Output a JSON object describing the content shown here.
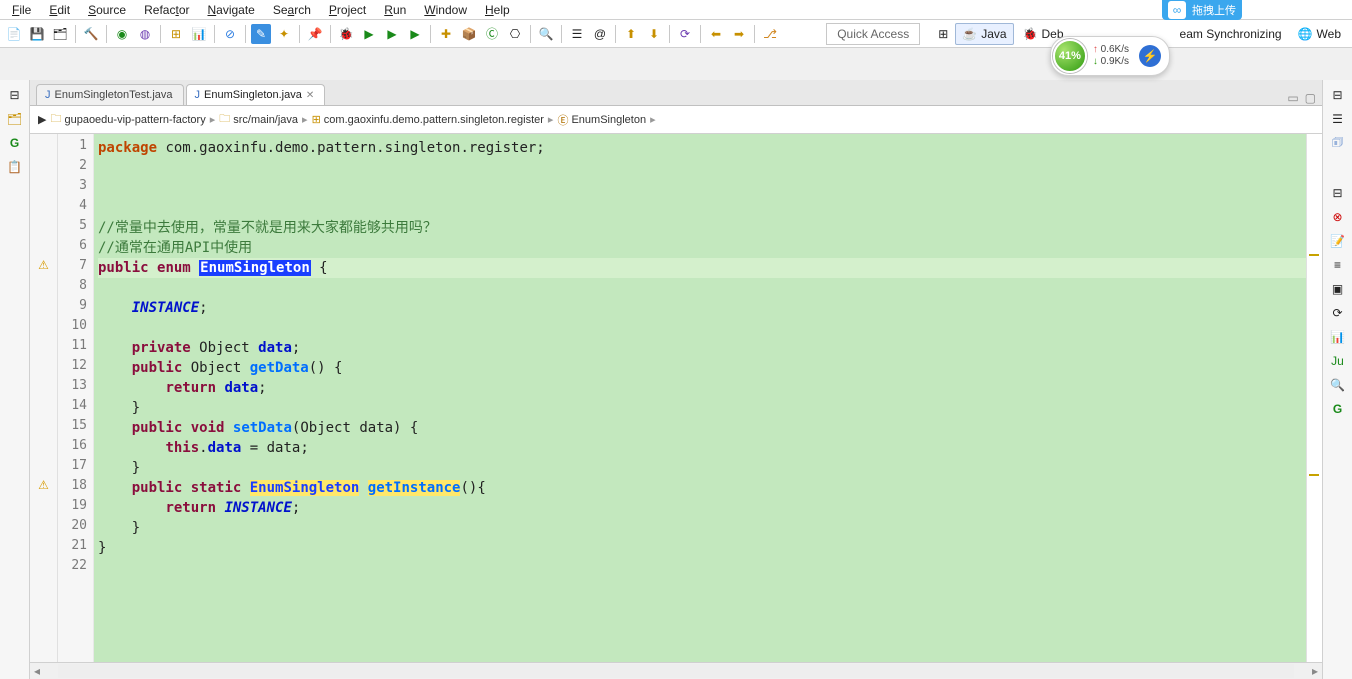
{
  "menu": {
    "file": "File",
    "edit": "Edit",
    "source": "Source",
    "refactor": "Refactor",
    "navigate": "Navigate",
    "search": "Search",
    "project": "Project",
    "run": "Run",
    "window": "Window",
    "help": "Help"
  },
  "quick_access": "Quick Access",
  "perspectives": {
    "java": "Java",
    "debug": "Debug",
    "team": "Team Synchronizing",
    "web": "Web"
  },
  "cloud": {
    "label": "拖拽上传"
  },
  "net": {
    "pct": "41%",
    "up": "0.6K/s",
    "down": "0.9K/s"
  },
  "tabs": {
    "t1": "EnumSingletonTest.java",
    "t2": "EnumSingleton.java"
  },
  "breadcrumb": {
    "b1": "gupaoedu-vip-pattern-factory",
    "b2": "src/main/java",
    "b3": "com.gaoxinfu.demo.pattern.singleton.register",
    "b4": "EnumSingleton"
  },
  "lines": [
    "1",
    "2",
    "3",
    "4",
    "5",
    "6",
    "7",
    "8",
    "9",
    "10",
    "11",
    "12",
    "13",
    "14",
    "15",
    "16",
    "17",
    "18",
    "19",
    "20",
    "21",
    "22"
  ],
  "code": {
    "l1_kw": "package",
    "l1_rest": " com.gaoxinfu.demo.pattern.singleton.register;",
    "l5": "//常量中去使用，常量不就是用来大家都能够共用吗？",
    "l6": "//通常在通用API中使用",
    "l7_a": "public",
    "l7_b": "enum",
    "l7_c": "EnumSingleton",
    "l7_d": " {",
    "l9": "INSTANCE",
    "l9_s": ";",
    "l11_a": "private",
    "l11_b": " Object ",
    "l11_c": "data",
    "l11_d": ";",
    "l12_a": "public",
    "l12_b": " Object ",
    "l12_c": "getData",
    "l12_d": "() {",
    "l13_a": "return",
    "l13_b": "data",
    "l13_c": ";",
    "l14": "}",
    "l15_a": "public",
    "l15_b": "void",
    "l15_c": "setData",
    "l15_d": "(Object data) {",
    "l16_a": "this",
    "l16_b": ".",
    "l16_c": "data",
    "l16_d": " = data;",
    "l17": "}",
    "l18_a": "public",
    "l18_b": "static",
    "l18_c": "EnumSingleton",
    "l18_d": "getInstance",
    "l18_e": "(){",
    "l19_a": "return",
    "l19_b": "INSTANCE",
    "l19_c": ";",
    "l20": "}",
    "l21": "}"
  }
}
